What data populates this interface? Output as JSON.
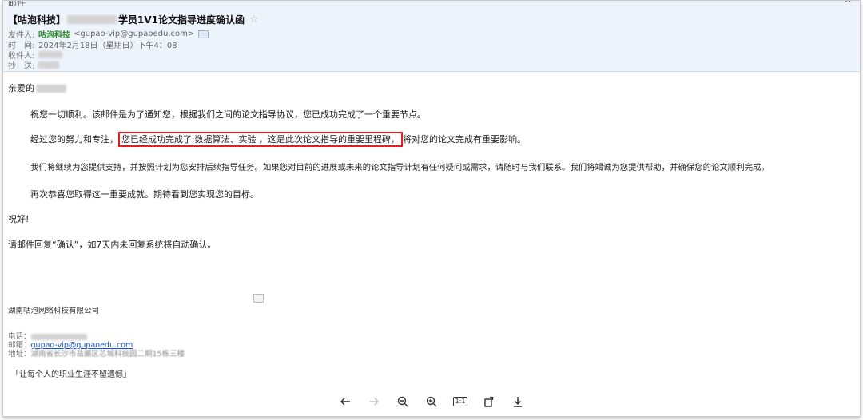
{
  "window": {
    "title": "邮件"
  },
  "email": {
    "subject_prefix": "【咕泡科技】",
    "subject_suffix": "学员1V1论文指导进度确认函",
    "from_label": "发件人:",
    "from_name": "咕泡科技",
    "from_email": "<gupao-vip@gupaoedu.com>",
    "time_label": "时　间:",
    "time_value": "2024年2月18日（星期日）下午4：08",
    "to_label": "收件人:",
    "cc_label": "抄　送:"
  },
  "body": {
    "greeting": "亲爱的",
    "para1": "祝您一切顺利。该邮件是为了通知您，根据我们之间的论文指导协议，您已成功完成了一个重要节点。",
    "para2_pre": "经过您的努力和专注，",
    "para2_highlight": "您已经成功完成了  数据算法、实验  ，这是此次论文指导的重要里程碑，",
    "para2_post": "将对您的论文完成有重要影响。",
    "para3": "我们将继续为您提供支持，并按照计划为您安排后续指导任务。如果您对目前的进展或未来的论文指导计划有任何疑问或需求，请随时与我们联系。我们将竭诚为您提供帮助，并确保您的论文顺利完成。",
    "para4": "再次恭喜您取得这一重要成就。期待看到您实现您的目标。",
    "closing": "祝好!",
    "reply_note": "请邮件回复“确认”，如7天内未回复系统将自动确认。"
  },
  "signature": {
    "company": "湖南咕泡网络科技有限公司",
    "phone_label": "电话：",
    "email_label": "邮箱：",
    "email_value": "gupao-vip@gupaoedu.com",
    "address_label": "地址：",
    "address_value": "湖南省长沙市岳麓区芯城科技园二期15栋三楼",
    "slogan": "「让每个人的职业生涯不留遗憾」"
  },
  "toolbar": {
    "prev": "previous-arrow-icon",
    "next": "next-arrow-icon",
    "zoom_out": "zoom-out-icon",
    "zoom_in": "zoom-in-icon",
    "actual_size": "1:1",
    "rotate": "rotate-icon",
    "download": "download-icon"
  },
  "colors": {
    "highlight_border": "#e02020",
    "header_bg": "#eef4fb",
    "sender_green": "#2f8a2f",
    "link_blue": "#1a54c6"
  }
}
